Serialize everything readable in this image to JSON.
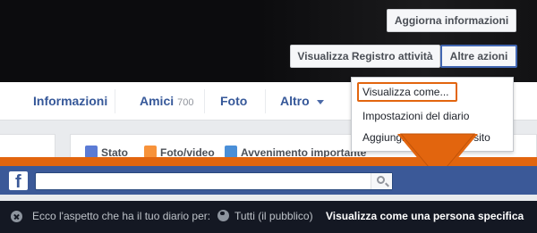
{
  "cover": {
    "update_info_label": "Aggiorna informazioni",
    "activity_log_label": "Visualizza Registro attività",
    "more_actions_label": "Altre azioni"
  },
  "tabs": {
    "info": "Informazioni",
    "friends": "Amici",
    "friends_count": "700",
    "photos": "Foto",
    "more": "Altro"
  },
  "composer": {
    "status": "Stato",
    "photo_video": "Foto/video",
    "event": "Avvenimento importante"
  },
  "menu": {
    "items": [
      "Visualizza come...",
      "Impostazioni del diario",
      "Aggiungi il diario al tuo sito"
    ]
  },
  "infobar": {
    "text": "Ecco l'aspetto che ha il tuo diario per:",
    "audience": "Tutti (il pubblico)",
    "view_as": "Visualizza come una persona specifica"
  },
  "colors": {
    "highlight": "#e2650e",
    "fb_blue": "#3b5998",
    "link": "#365899",
    "infobar_bg": "#141823"
  }
}
